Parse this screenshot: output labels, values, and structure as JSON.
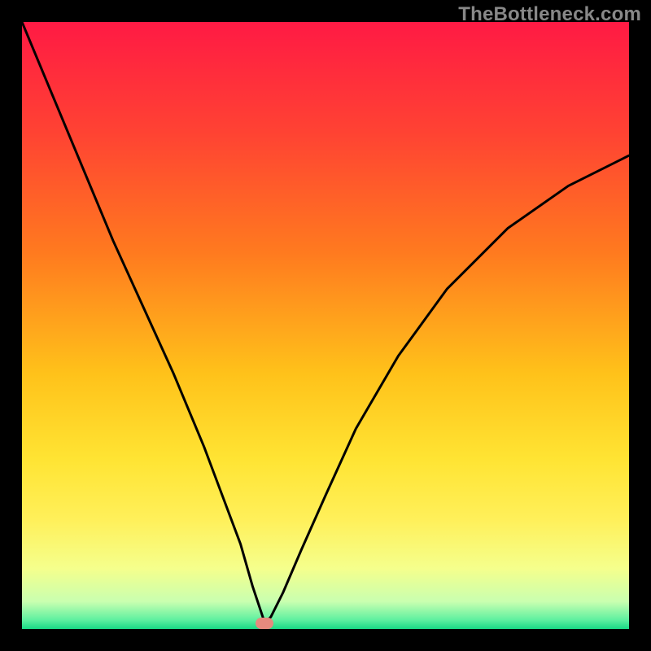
{
  "watermark": "TheBottleneck.com",
  "colors": {
    "frame_border": "#000000",
    "curve": "#000000",
    "marker": "#e68a7e",
    "gradient_stops": [
      {
        "offset": 0.0,
        "color": "#ff1a44"
      },
      {
        "offset": 0.18,
        "color": "#ff4233"
      },
      {
        "offset": 0.38,
        "color": "#ff7a1f"
      },
      {
        "offset": 0.58,
        "color": "#ffc21a"
      },
      {
        "offset": 0.72,
        "color": "#ffe433"
      },
      {
        "offset": 0.82,
        "color": "#fff05a"
      },
      {
        "offset": 0.9,
        "color": "#f5ff8c"
      },
      {
        "offset": 0.955,
        "color": "#c9ffb0"
      },
      {
        "offset": 0.985,
        "color": "#5ef0a0"
      },
      {
        "offset": 1.0,
        "color": "#18d884"
      }
    ]
  },
  "chart_data": {
    "type": "line",
    "title": "",
    "xlabel": "",
    "ylabel": "",
    "xlim": [
      0,
      100
    ],
    "ylim": [
      0,
      100
    ],
    "grid": false,
    "curve_minimum_x": 40,
    "curve_minimum_y": 1,
    "marker": {
      "x": 40,
      "y": 1
    },
    "series": [
      {
        "name": "bottleneck-curve",
        "x": [
          0,
          5,
          10,
          15,
          20,
          25,
          30,
          33,
          36,
          38,
          39.5,
          40,
          41,
          43,
          46,
          50,
          55,
          62,
          70,
          80,
          90,
          100
        ],
        "y": [
          100,
          88,
          76,
          64,
          53,
          42,
          30,
          22,
          14,
          7,
          2.5,
          1,
          2,
          6,
          13,
          22,
          33,
          45,
          56,
          66,
          73,
          78
        ]
      }
    ]
  }
}
